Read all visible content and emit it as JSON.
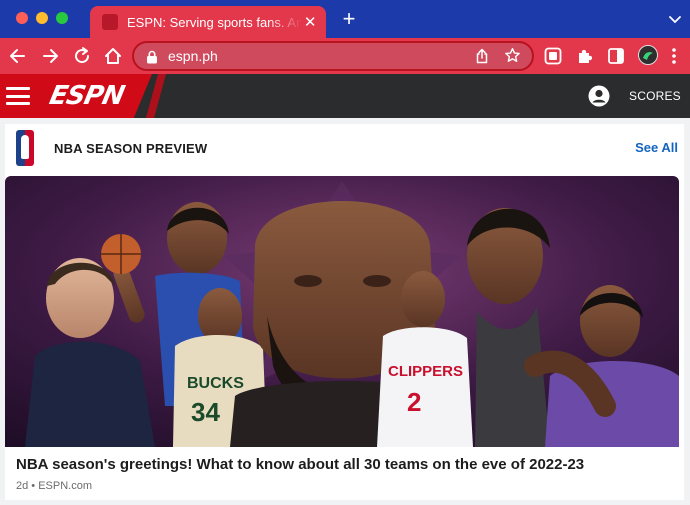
{
  "browser": {
    "tab_title": "ESPN: Serving sports fans. Anytime. Anywhere.",
    "tab_close": "✕",
    "new_tab": "+",
    "url": "espn.ph"
  },
  "espn_nav": {
    "logo": "ESPN",
    "scores_label": "SCORES"
  },
  "section": {
    "title": "NBA SEASON PREVIEW",
    "see_all": "See All"
  },
  "article": {
    "headline": "NBA season's greetings! What to know about all 30 teams on the eve of 2022-23",
    "meta": "2d • ESPN.com",
    "jersey_left": "34",
    "jersey_right": "2"
  },
  "colors": {
    "tab_strip": "#1c3aa9",
    "toolbar": "#e3374b",
    "espn_red": "#d00a16",
    "nav_dark": "#2b2c2d",
    "link_blue": "#1465c0"
  }
}
